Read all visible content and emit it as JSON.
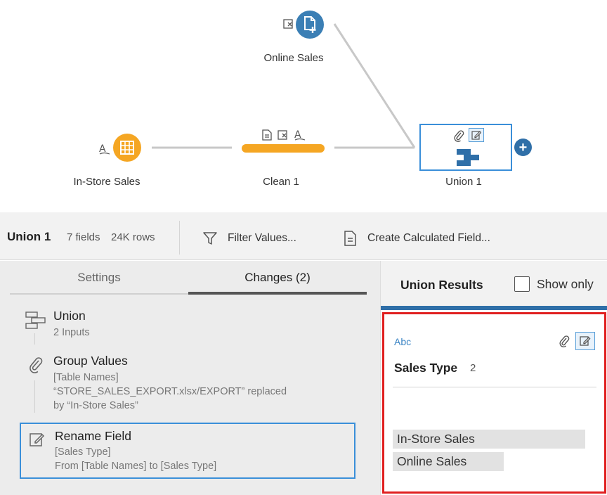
{
  "flow": {
    "nodes": {
      "online_sales": {
        "label": "Online Sales"
      },
      "in_store_sales": {
        "label": "In-Store Sales"
      },
      "clean": {
        "label": "Clean 1"
      },
      "union": {
        "label": "Union 1"
      }
    },
    "colors": {
      "input_node": "#f5a623",
      "union_node": "#2f6fa8",
      "online_node": "#3b7fb5",
      "selection": "#3a8fd9"
    }
  },
  "toolbar": {
    "step_name": "Union 1",
    "fields": "7 fields",
    "rows": "24K rows",
    "filter_label": "Filter Values...",
    "calc_label": "Create Calculated Field..."
  },
  "left_panel": {
    "tabs": [
      "Settings",
      "Changes (2)"
    ],
    "changes": [
      {
        "title": "Union",
        "details": [
          "2 Inputs"
        ],
        "icon": "union-icon"
      },
      {
        "title": "Group Values",
        "details": [
          "[Table Names]",
          "“STORE_SALES_EXPORT.xlsx/EXPORT” replaced",
          "by “In-Store Sales”"
        ],
        "icon": "paperclip-icon"
      },
      {
        "title": "Rename Field",
        "details": [
          "[Sales Type]",
          "From [Table Names] to [Sales Type]"
        ],
        "icon": "edit-icon"
      }
    ]
  },
  "right_panel": {
    "title": "Union Results",
    "show_only": "Show only",
    "field": {
      "type": "Abc",
      "name": "Sales Type",
      "count": "2",
      "values": [
        "In-Store Sales",
        "Online Sales"
      ]
    }
  }
}
